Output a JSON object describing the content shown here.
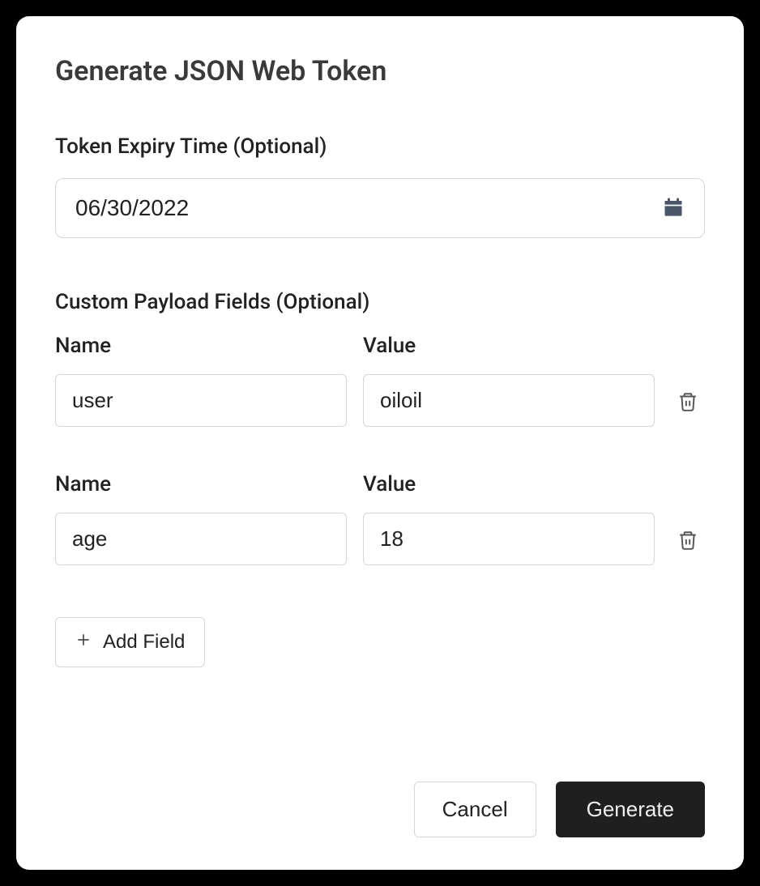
{
  "modal": {
    "title": "Generate JSON Web Token",
    "expiry": {
      "label": "Token Expiry Time (Optional)",
      "value": "06/30/2022"
    },
    "payload": {
      "label": "Custom Payload Fields (Optional)",
      "nameLabel": "Name",
      "valueLabel": "Value",
      "fields": [
        {
          "name": "user",
          "value": "oiloil"
        },
        {
          "name": "age",
          "value": "18"
        }
      ],
      "addFieldLabel": "Add Field"
    },
    "footer": {
      "cancel": "Cancel",
      "generate": "Generate"
    }
  }
}
